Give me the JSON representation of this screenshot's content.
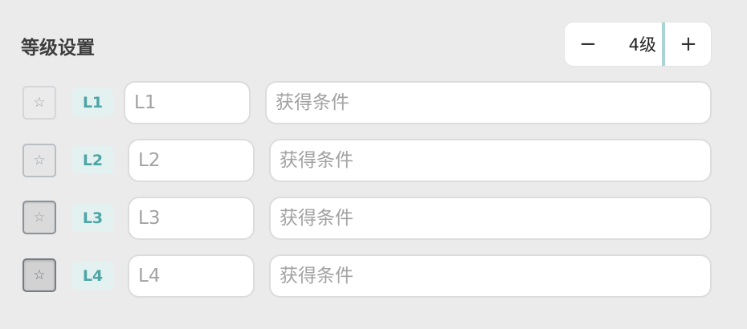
{
  "header": {
    "title": "等级设置"
  },
  "stepper": {
    "minus_label": "−",
    "value": "4级",
    "plus_label": "+"
  },
  "levels": [
    {
      "badge": "L1",
      "name_placeholder": "L1",
      "condition_placeholder": "获得条件",
      "star_icon": "☆"
    },
    {
      "badge": "L2",
      "name_placeholder": "L2",
      "condition_placeholder": "获得条件",
      "star_icon": "☆"
    },
    {
      "badge": "L3",
      "name_placeholder": "L3",
      "condition_placeholder": "获得条件",
      "star_icon": "☆"
    },
    {
      "badge": "L4",
      "name_placeholder": "L4",
      "condition_placeholder": "获得条件",
      "star_icon": "☆"
    }
  ],
  "colors": {
    "accent": "#4ea5a5",
    "badge_bg": "#e3f1f1",
    "divider": "#a8d4d4"
  }
}
